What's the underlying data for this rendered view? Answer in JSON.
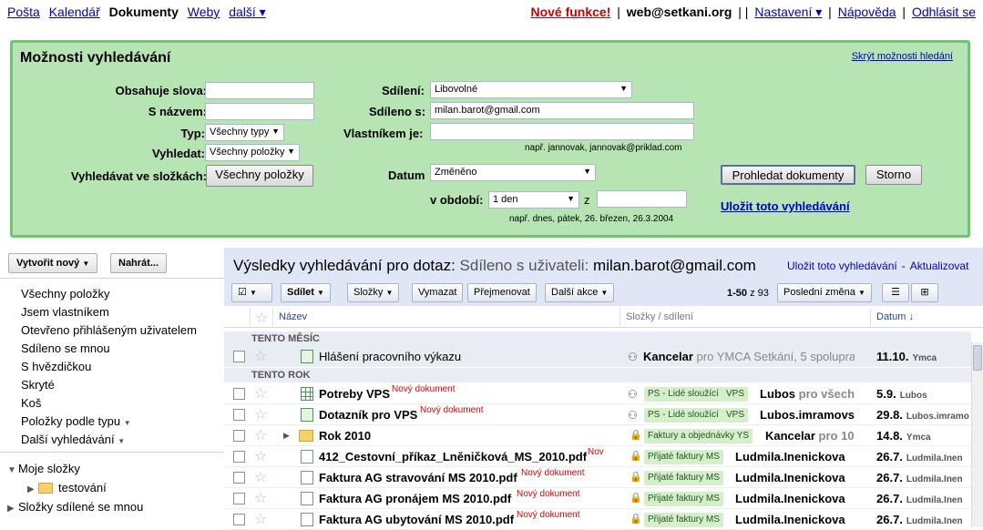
{
  "topnav": {
    "items": [
      "Pošta",
      "Kalendář",
      "Dokumenty",
      "Weby",
      "další ▾"
    ],
    "active_index": 2
  },
  "topright": {
    "new_features": "Nové funkce!",
    "account": "web@setkani.org",
    "settings": "Nastavení ▾",
    "help": "Nápověda",
    "signout": "Odhlásit se"
  },
  "search_options": {
    "title": "Možnosti vyhledávání",
    "hide": "Skrýt možnosti hledání",
    "contains_label": "Obsahuje slova:",
    "contains_value": "",
    "name_label": "S názvem:",
    "name_value": "",
    "type_label": "Typ:",
    "type_value": "Všechny typy",
    "search_label": "Vyhledat:",
    "search_value": "Všechny položky",
    "folders_label": "Vyhledávat ve složkách:",
    "folders_button": "Všechny položky",
    "sharing_label": "Sdílení:",
    "sharing_value": "Libovolné",
    "shared_with_label": "Sdíleno s:",
    "shared_with_value": "milan.barot@gmail.com",
    "owner_label": "Vlastníkem je:",
    "owner_value": "",
    "owner_hint": "např. jannovak, jannovak@priklad.com",
    "date_label": "Datum",
    "date_value": "Změněno",
    "period_label": "v období:",
    "period_value": "1 den",
    "period_z": "z",
    "period_to_value": "",
    "date_hint": "např. dnes, pátek, 26. březen, 26.3.2004",
    "search_button": "Prohledat dokumenty",
    "cancel_button": "Storno",
    "save_search": "Uložit toto vyhledávání"
  },
  "left": {
    "create_new": "Vytvořit nový",
    "upload": "Nahrát...",
    "nav": [
      "Všechny položky",
      "Jsem vlastníkem",
      "Otevřeno přihlášeným uživatelem",
      "Sdíleno se mnou",
      "S hvězdičkou",
      "Skryté",
      "Koš",
      "Položky podle typu",
      "Další vyhledávání"
    ],
    "my_folders": "Moje složky",
    "subfolder": "testování",
    "shared_folders": "Složky sdílené se mnou"
  },
  "results": {
    "title_prefix": "Výsledky vyhledávání pro dotaz:",
    "title_query": "Sdíleno s uživateli:",
    "title_email": "milan.barot@gmail.com",
    "save_link": "Uložit toto vyhledávání",
    "refresh_link": "Aktualizovat"
  },
  "toolbar": {
    "share": "Sdílet",
    "folders": "Složky",
    "delete": "Vymazat",
    "rename": "Přejmenovat",
    "more": "Další akce",
    "page_info_range": "1-50",
    "page_info_rest": "z 93",
    "sort": "Poslední změna"
  },
  "table": {
    "col_name": "Název",
    "col_folders": "Složky / sdílení",
    "col_date": "Datum",
    "sort_arrow": "↓",
    "group_month": "TENTO MĚSÍC",
    "group_year": "TENTO ROK",
    "rows": [
      {
        "name": "Hlášení pracovního výkazu",
        "new": "",
        "tags": [],
        "owner": "Kancelar",
        "owner_rest": "pro YMCA Setkání, 5 spolupra",
        "date": "11.10.",
        "who": "Ymca",
        "icon": "form-icon"
      },
      {
        "name": "Potreby VPS",
        "new": "Nový dokument",
        "tags": [
          "PS - Lidé sloužící",
          "VPS"
        ],
        "owner": "Lubos",
        "owner_rest": "pro všech",
        "date": "5.9.",
        "who": "Lubos",
        "icon": "spreadsheet-icon"
      },
      {
        "name": "Dotazník pro VPS",
        "new": "Nový dokument",
        "tags": [
          "PS - Lidé sloužící",
          "VPS"
        ],
        "owner": "Lubos.imramovs",
        "owner_rest": "",
        "date": "29.8.",
        "who": "Lubos.imramo",
        "icon": "form-icon"
      },
      {
        "name": "Rok 2010",
        "new": "",
        "tags": [
          "Faktury a objednávky YS"
        ],
        "owner": "Kancelar",
        "owner_rest": "pro 10",
        "date": "14.8.",
        "who": "Ymca",
        "icon": "folder-icon"
      },
      {
        "name": "412_Cestovní_příkaz_Lněničková_MS_2010.pdf",
        "new": "Nov",
        "tags": [
          "Přijaté faktury MS"
        ],
        "owner": "Ludmila.Inenickova",
        "owner_rest": "",
        "date": "26.7.",
        "who": "Ludmila.Inen",
        "icon": "pdf-icon"
      },
      {
        "name": "Faktura AG stravování MS 2010.pdf",
        "new": "Nový dokument",
        "tags": [
          "Přijaté faktury MS"
        ],
        "owner": "Ludmila.Inenickova",
        "owner_rest": "",
        "date": "26.7.",
        "who": "Ludmila.Inen",
        "icon": "pdf-icon"
      },
      {
        "name": "Faktura AG pronájem MS 2010.pdf",
        "new": "Nový dokument",
        "tags": [
          "Přijaté faktury MS"
        ],
        "owner": "Ludmila.Inenickova",
        "owner_rest": "",
        "date": "26.7.",
        "who": "Ludmila.Inen",
        "icon": "pdf-icon"
      },
      {
        "name": "Faktura AG ubytování MS 2010.pdf",
        "new": "Nový dokument",
        "tags": [
          "Přijaté faktury MS"
        ],
        "owner": "Ludmila.Inenickova",
        "owner_rest": "",
        "date": "26.7.",
        "who": "Ludmila.Inen",
        "icon": "pdf-icon"
      }
    ]
  },
  "colors": {
    "panel_bg": "#b6e4b2",
    "panel_border": "#71c46f",
    "link": "#0000cc",
    "alert": "#cc0000",
    "header_bg": "#dfe6f6",
    "tag_bg": "#d4efc9"
  }
}
